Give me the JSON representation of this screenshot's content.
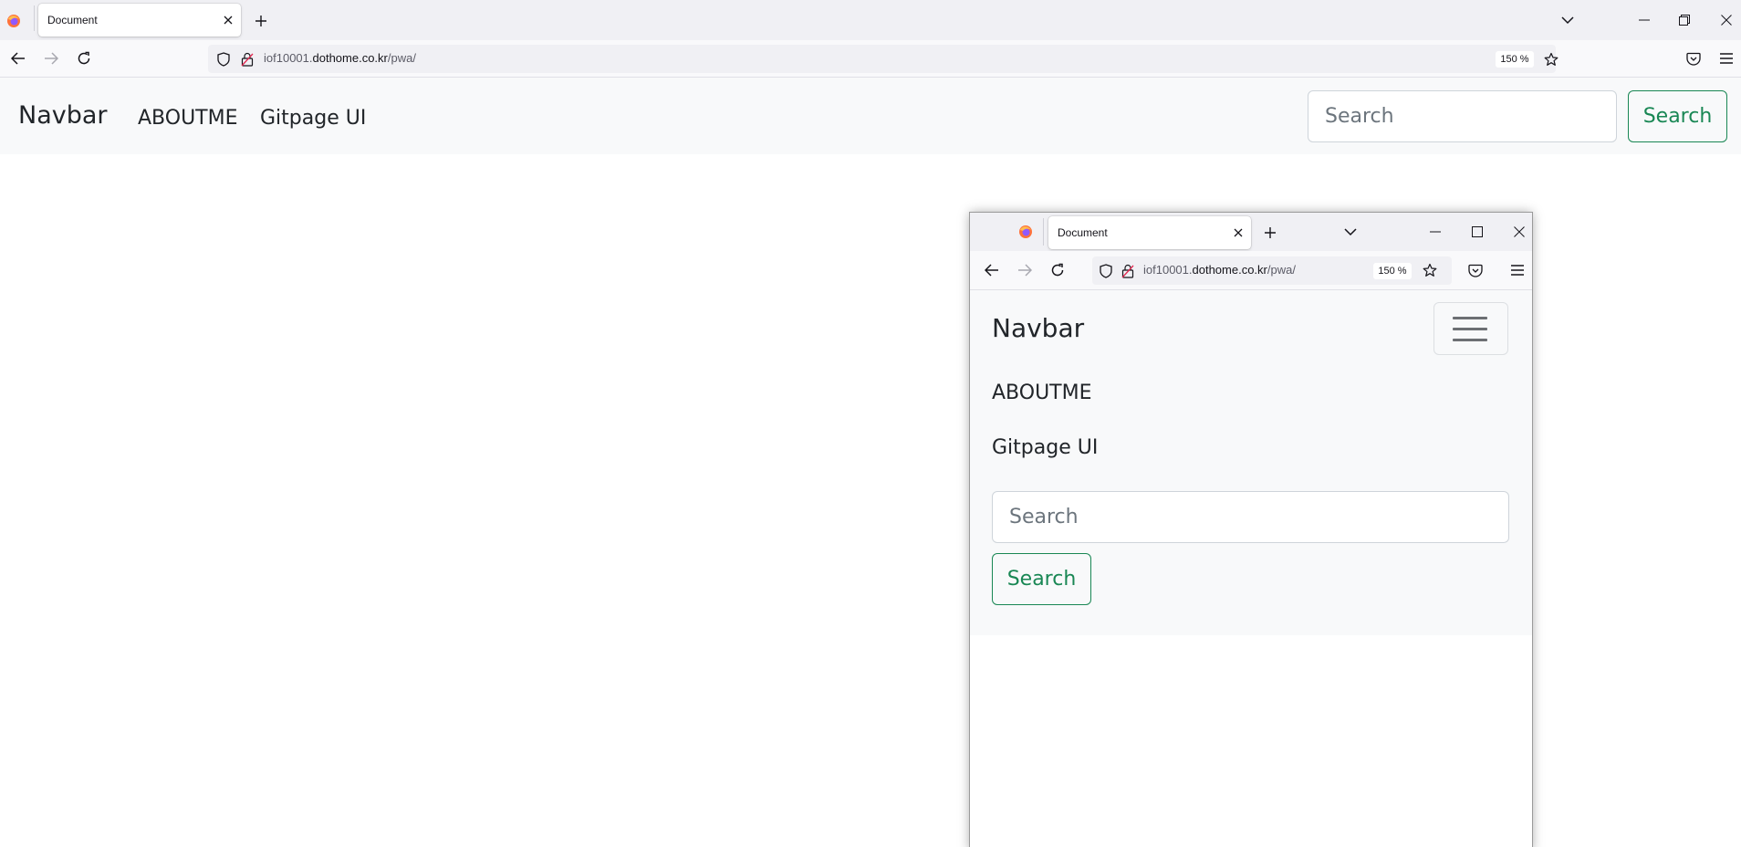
{
  "browser": {
    "tab_title": "Document",
    "url_prefix": "iof10001.",
    "url_host": "dothome.co.kr",
    "url_path": "/pwa/",
    "zoom": "150 %"
  },
  "page": {
    "brand": "Navbar",
    "nav_links": [
      "ABOUTME",
      "Gitpage UI"
    ],
    "search_placeholder": "Search",
    "search_button": "Search"
  },
  "inner_window": {
    "tab_title": "Document",
    "url_prefix": "iof10001.",
    "url_host": "dothome.co.kr",
    "url_path": "/pwa/",
    "zoom": "150 %",
    "brand": "Navbar",
    "nav_links": [
      "ABOUTME",
      "Gitpage UI"
    ],
    "search_placeholder": "Search",
    "search_button": "Search"
  },
  "colors": {
    "navbar_bg": "#f8f9fa",
    "success": "#198754",
    "chrome_bg": "#f0f0f4"
  },
  "icons": [
    "firefox-icon",
    "close-icon",
    "plus-icon",
    "chevron-down-icon",
    "minimize-icon",
    "restore-icon",
    "maximize-icon",
    "back-icon",
    "forward-icon",
    "reload-icon",
    "shield-icon",
    "lock-icon",
    "star-icon",
    "pocket-icon",
    "menu-icon",
    "hamburger-icon"
  ]
}
